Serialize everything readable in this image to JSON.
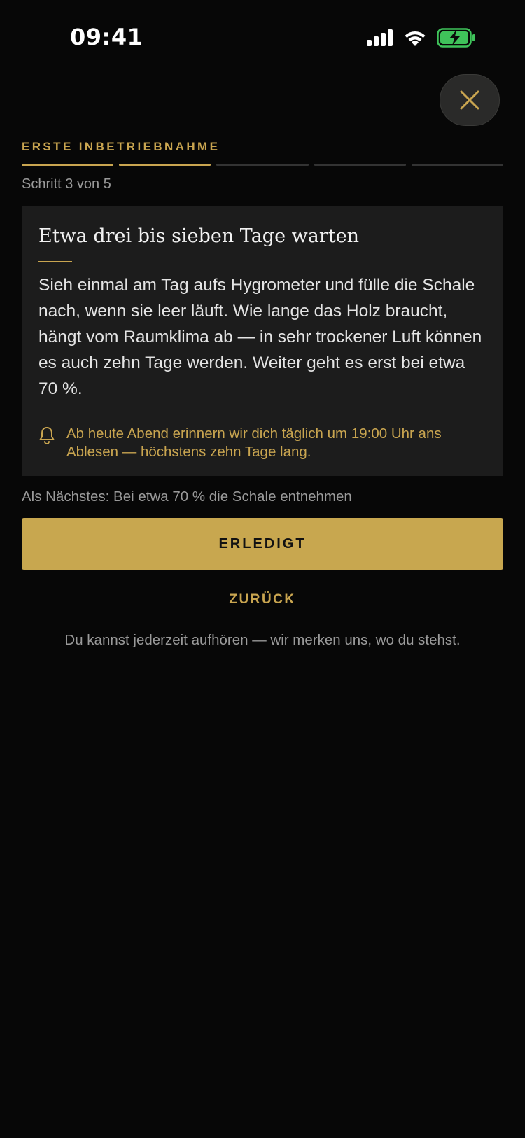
{
  "status_bar": {
    "time": "09:41",
    "icons": [
      "cellular-signal-icon",
      "wifi-icon",
      "battery-charging-icon"
    ]
  },
  "header": {
    "close_icon": "close-icon",
    "flow_label": "ERSTE INBETRIEBNAHME",
    "progress": {
      "current_step": 3,
      "total_steps": 5,
      "completed_segments": 2
    },
    "step_text": "Schritt 3 von 5"
  },
  "card": {
    "title": "Etwa drei bis sieben Tage warten",
    "body": "Sieh einmal am Tag aufs Hygrometer und fülle die Schale nach, wenn sie leer läuft. Wie lange das Holz braucht, hängt vom Raumklima ab — in sehr trockener Luft können es auch zehn Tage werden. Weiter geht es erst bei etwa 70 %.",
    "reminder_icon": "bell-icon",
    "reminder": "Ab heute Abend erinnern wir dich täglich um 19:00 Uhr ans Ablesen — höchstens zehn Tage lang."
  },
  "next_hint": "Als Nächstes: Bei etwa 70 % die Schale entnehmen",
  "actions": {
    "primary": "ERLEDIGT",
    "back": "ZURÜCK"
  },
  "footnote": "Du kannst jederzeit aufhören — wir merken uns, wo du stehst.",
  "colors": {
    "background": "#070707",
    "accent_gold": "#c9a550",
    "card": "#1c1c1c",
    "battery_green": "#3fc35a"
  }
}
